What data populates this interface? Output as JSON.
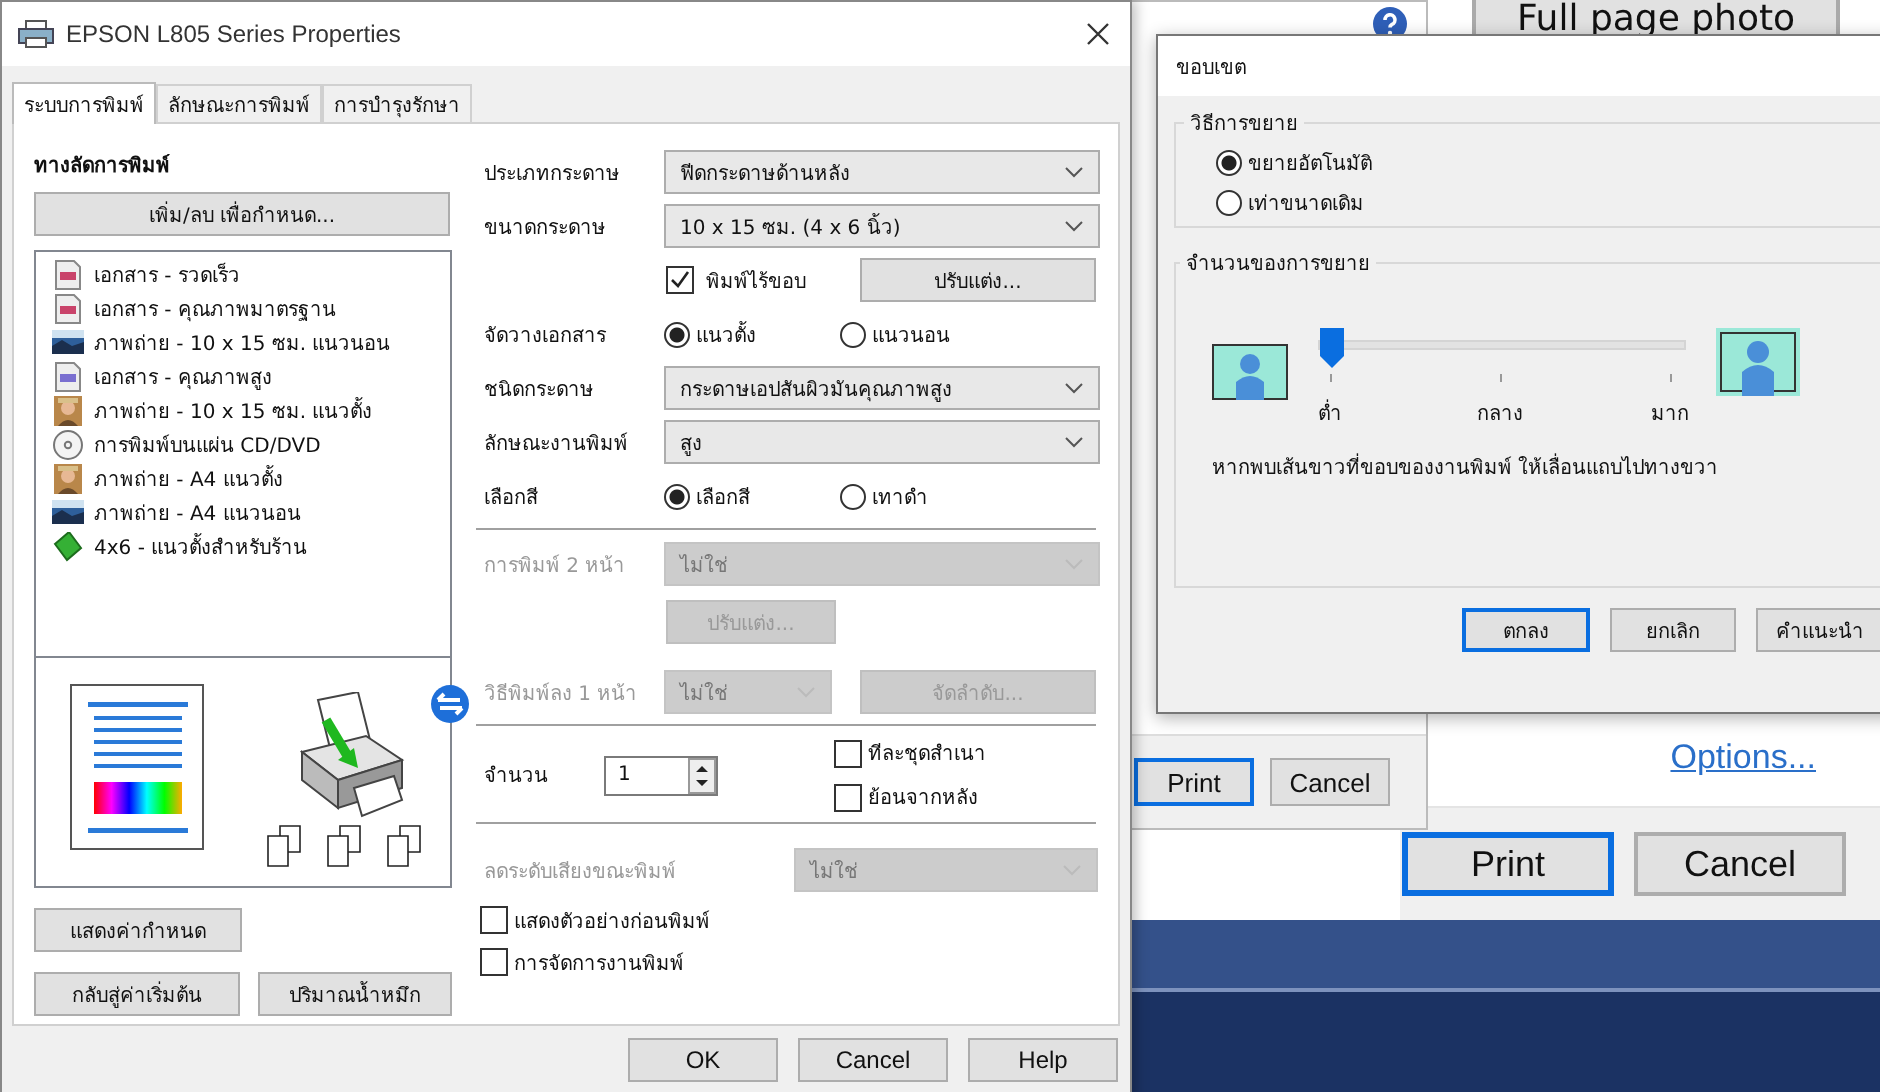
{
  "back_window": {
    "top_button": "Full page photo",
    "options_link": "Options...",
    "buttons": [
      {
        "label": "Print",
        "default": true
      },
      {
        "label": "Cancel",
        "default": false
      }
    ]
  },
  "middle_window": {
    "buttons": [
      {
        "label": "Print",
        "default": true
      },
      {
        "label": "Cancel",
        "default": false
      }
    ]
  },
  "main_window": {
    "title": "EPSON L805 Series Properties",
    "tabs": [
      {
        "label": "ระบบการพิมพ์",
        "selected": true
      },
      {
        "label": "ลักษณะการพิมพ์",
        "selected": false
      },
      {
        "label": "การบำรุงรักษา",
        "selected": false
      }
    ],
    "presets": {
      "heading": "ทางลัดการพิมพ์",
      "edit_button": "เพิ่ม/ลบ เพื่อกำหนด...",
      "items": [
        {
          "label": "เอกสาร - รวดเร็ว",
          "kind": "document"
        },
        {
          "label": "เอกสาร - คุณภาพมาตรฐาน",
          "kind": "document"
        },
        {
          "label": "ภาพถ่าย - 10 x 15 ซม. แนวนอน",
          "kind": "landscape"
        },
        {
          "label": "เอกสาร - คุณภาพสูง",
          "kind": "document_hq"
        },
        {
          "label": "ภาพถ่าย - 10 x 15 ซม. แนวตั้ง",
          "kind": "portrait"
        },
        {
          "label": "การพิมพ์บนแผ่น CD/DVD",
          "kind": "disc"
        },
        {
          "label": "ภาพถ่าย - A4 แนวตั้ง",
          "kind": "portrait"
        },
        {
          "label": "ภาพถ่าย - A4 แนวนอน",
          "kind": "landscape"
        },
        {
          "label": "4x6 - แนวตั้งสำหรับร้าน",
          "kind": "shop"
        }
      ]
    },
    "left_buttons": [
      "แสดงค่ากำหนด",
      "กลับสู่ค่าเริ่มต้น",
      "ปริมาณน้ำหมึก"
    ],
    "sections": [
      {
        "rows": [
          {
            "kind": "select",
            "label": "ประเภทกระดาษ",
            "value": "ฟีดกระดาษด้านหลัง",
            "disabled": false
          },
          {
            "kind": "select",
            "label": "ขนาดกระดาษ",
            "value": "10 x 15 ซม. (4 x 6 นิ้ว)",
            "disabled": false
          },
          {
            "kind": "check_button",
            "check": {
              "label": "พิมพ์ไร้ขอบ",
              "checked": true
            },
            "button": "ปรับแต่ง...",
            "disabled": false
          },
          {
            "kind": "radio",
            "label": "จัดวางเอกสาร",
            "options": [
              {
                "label": "แนวตั้ง",
                "selected": true
              },
              {
                "label": "แนวนอน",
                "selected": false
              }
            ]
          },
          {
            "kind": "select",
            "label": "ชนิดกระดาษ",
            "value": "กระดาษเอปสันผิวมันคุณภาพสูง",
            "disabled": false
          },
          {
            "kind": "select",
            "label": "ลักษณะงานพิมพ์",
            "value": "สูง",
            "disabled": false
          },
          {
            "kind": "radio",
            "label": "เลือกสี",
            "options": [
              {
                "label": "เลือกสี",
                "selected": true
              },
              {
                "label": "เทาดำ",
                "selected": false
              }
            ]
          }
        ]
      },
      {
        "rows": [
          {
            "kind": "select",
            "label": "การพิมพ์ 2 หน้า",
            "value": "ไม่ใช่",
            "disabled": true
          },
          {
            "kind": "button",
            "button": "ปรับแต่ง...",
            "disabled": true
          },
          {
            "kind": "select_button",
            "label": "วิธีพิมพ์ลง 1 หน้า",
            "value": "ไม่ใช่",
            "button": "จัดลำดับ...",
            "disabled": true
          }
        ]
      },
      {
        "rows": [
          {
            "kind": "copies",
            "label": "จำนวน",
            "value": "1",
            "checks": [
              {
                "label": "ทีละชุดสำเนา",
                "checked": false
              },
              {
                "label": "ย้อนจากหลัง",
                "checked": false
              }
            ]
          }
        ]
      },
      {
        "rows": [
          {
            "kind": "wide_select",
            "label": "ลดระดับเสียงขณะพิมพ์",
            "value": "ไม่ใช่",
            "disabled": true
          },
          {
            "kind": "check",
            "check": {
              "label": "แสดงตัวอย่างก่อนพิมพ์",
              "checked": false
            }
          },
          {
            "kind": "check",
            "check": {
              "label": "การจัดการงานพิมพ์",
              "checked": false
            }
          }
        ]
      }
    ],
    "buttons": [
      "OK",
      "Cancel",
      "Help"
    ]
  },
  "margin_dialog": {
    "title": "ขอบเขต",
    "method": {
      "heading": "วิธีการขยาย",
      "options": [
        {
          "label": "ขยายอัตโนมัติ",
          "selected": true
        },
        {
          "label": "เท่าขนาดเดิม",
          "selected": false
        }
      ]
    },
    "amount": {
      "heading": "จำนวนของการขยาย",
      "level": 0,
      "ticks": [
        "ต่ำ",
        "กลาง",
        "มาก"
      ],
      "note": "หากพบเส้นขาวที่ขอบของงานพิมพ์ ให้เลื่อนแถบไปทางขวา"
    },
    "buttons": [
      {
        "label": "ตกลง",
        "default": true
      },
      {
        "label": "ยกเลิก",
        "default": false
      },
      {
        "label": "คำแนะนำ",
        "default": false
      }
    ]
  }
}
